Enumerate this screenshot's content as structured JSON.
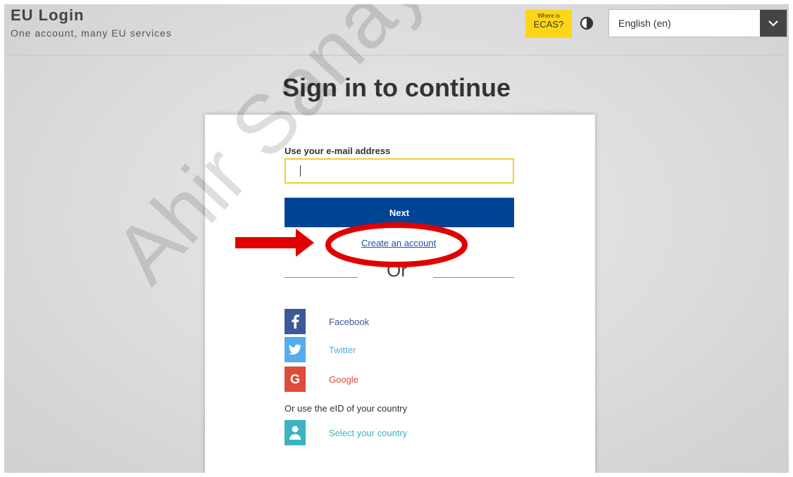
{
  "header": {
    "app_title": "EU Login",
    "tagline": "One account, many EU services",
    "ecas_top": "Where is",
    "ecas_bottom": "ECAS?",
    "language_selected": "English (en)"
  },
  "main": {
    "page_title": "Sign in to continue",
    "email_label": "Use your e-mail address",
    "next_label": "Next",
    "create_account_label": "Create an account",
    "or_label": "Or",
    "social": [
      {
        "label": "Facebook",
        "color": "#3b5998",
        "text_color": "#3b5998",
        "icon": "facebook-icon"
      },
      {
        "label": "Twitter",
        "color": "#55acee",
        "text_color": "#55acee",
        "icon": "twitter-icon"
      },
      {
        "label": "Google",
        "color": "#dd4b39",
        "text_color": "#dd4b39",
        "icon": "google-icon"
      }
    ],
    "eid_label": "Or use the eID of your country",
    "select_country_label": "Select your country"
  },
  "watermark": "Ahir Sanayi Odasi",
  "colors": {
    "accent_blue": "#004494",
    "ecas_yellow": "#ffd617",
    "input_border": "#f3cf2a",
    "annotation_red": "#e00000"
  }
}
